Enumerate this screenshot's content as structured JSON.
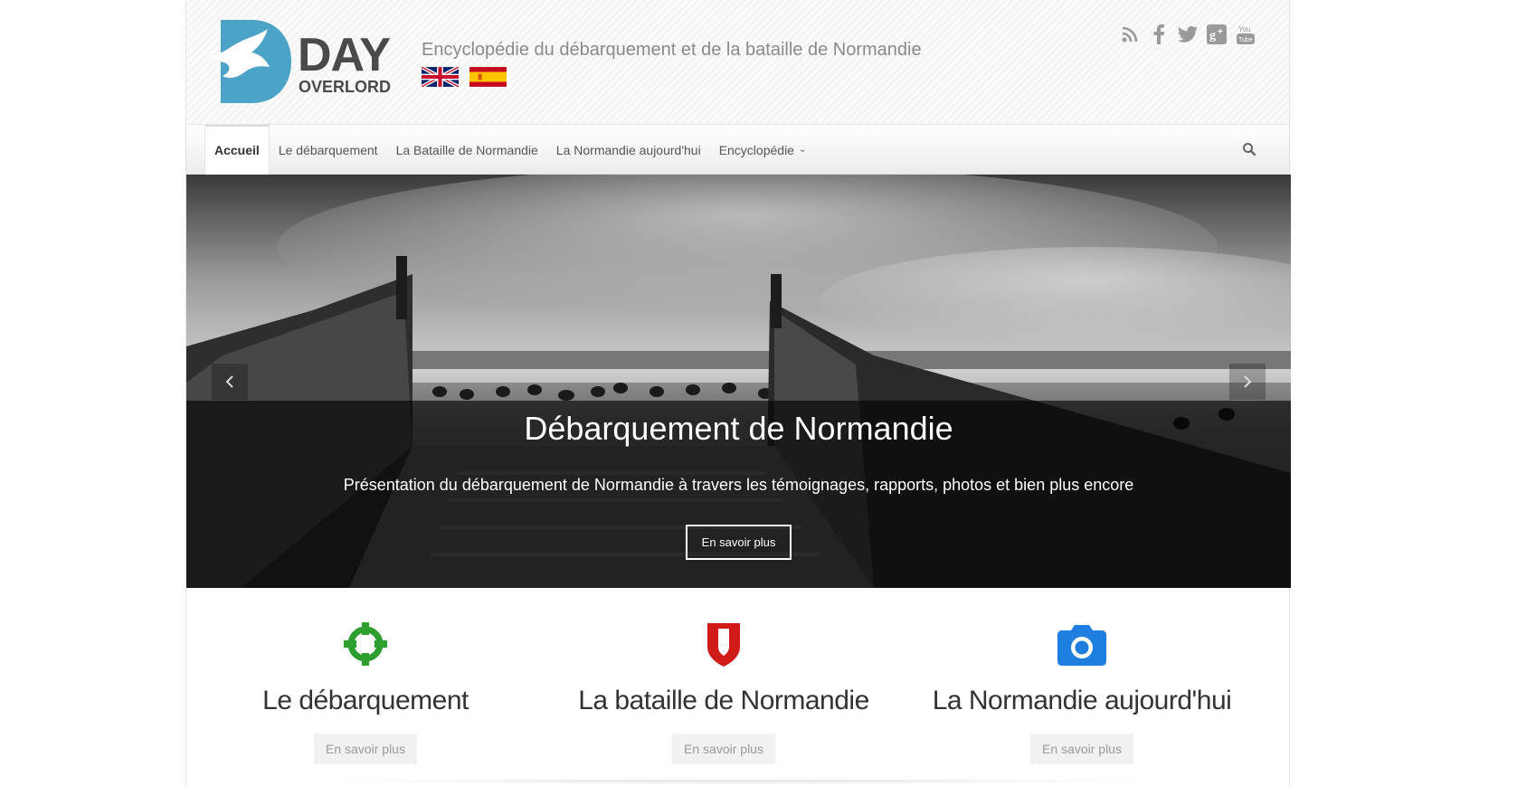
{
  "header": {
    "logo_day": "DAY",
    "logo_overlord": "OVERLORD",
    "tagline": "Encyclopédie du débarquement et de la bataille de Normandie",
    "flags": [
      "uk-flag-icon",
      "spain-flag-icon"
    ],
    "social_icons": [
      "rss-icon",
      "facebook-icon",
      "twitter-icon",
      "google-plus-icon",
      "youtube-icon"
    ],
    "youtube_text_1": "You",
    "youtube_text_2": "Tube"
  },
  "nav": {
    "items": [
      {
        "label": "Accueil"
      },
      {
        "label": "Le débarquement"
      },
      {
        "label": "La Bataille de Normandie"
      },
      {
        "label": "La Normandie aujourd'hui"
      },
      {
        "label": "Encyclopédie"
      }
    ],
    "search_icon": "search-icon"
  },
  "hero": {
    "title": "Débarquement de Normandie",
    "subtitle": "Présentation du débarquement de Normandie à travers les témoignages, rapports, photos et bien plus encore",
    "button": "En savoir plus"
  },
  "features": [
    {
      "icon": "crosshair-icon",
      "title": "Le débarquement",
      "button": "En savoir plus",
      "color": "#2e9e2e"
    },
    {
      "icon": "shield-icon",
      "title": "La bataille de Normandie",
      "button": "En savoir plus",
      "color": "#d11a1a"
    },
    {
      "icon": "camera-icon",
      "title": "La Normandie aujourd'hui",
      "button": "En savoir plus",
      "color": "#1f7fe0"
    }
  ],
  "colors": {
    "logo_blue": "#4ba3c7",
    "text_dark": "#4a4a4a"
  }
}
